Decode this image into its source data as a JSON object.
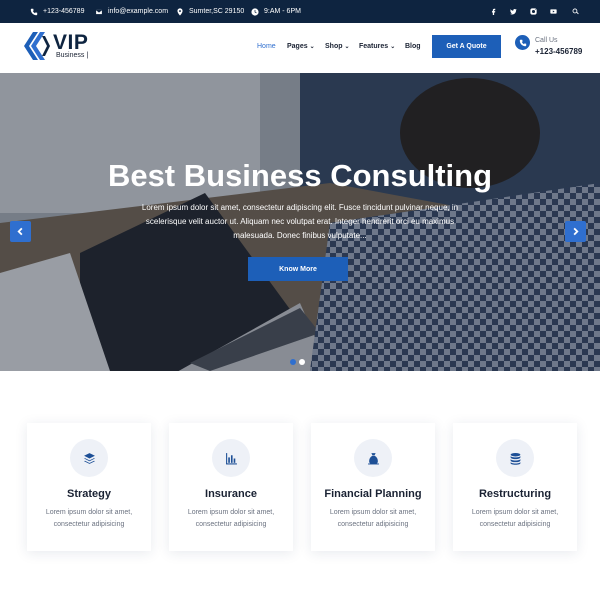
{
  "topbar": {
    "phone": "+123-456789",
    "email": "info@example.com",
    "location": "Sumter,SC 29150",
    "hours": "9:AM - 6PM",
    "social_icons": [
      "facebook-icon",
      "twitter-icon",
      "instagram-icon",
      "youtube-icon",
      "search-icon"
    ]
  },
  "header": {
    "logo_title": "VIP",
    "logo_subtitle": "Business |",
    "nav": [
      {
        "label": "Home",
        "active": true
      },
      {
        "label": "Pages",
        "dropdown": true
      },
      {
        "label": "Shop",
        "dropdown": true
      },
      {
        "label": "Features",
        "dropdown": true
      },
      {
        "label": "Blog"
      }
    ],
    "quote_button": "Get A Quote",
    "call_label": "Call Us",
    "call_number": "+123-456789"
  },
  "hero": {
    "title": "Best Business Consulting",
    "text": "Lorem ipsum dolor sit amet, consectetur adipiscing elit. Fusce tincidunt pulvinar neque, in scelerisque velit auctor ut. Aliquam nec volutpat erat. Integer hendrerit orci eu maximus malesuada. Donec finibus vulputate...",
    "button": "Know More",
    "slides_count": 2,
    "active_slide": 1
  },
  "services": [
    {
      "title": "Strategy",
      "text": "Lorem ipsum dolor sit amet, consectetur adipisicing",
      "icon": "layers-icon"
    },
    {
      "title": "Insurance",
      "text": "Lorem ipsum dolor sit amet, consectetur adipisicing",
      "icon": "bar-chart-icon"
    },
    {
      "title": "Financial Planning",
      "text": "Lorem ipsum dolor sit amet, consectetur adipisicing",
      "icon": "money-bag-icon"
    },
    {
      "title": "Restructuring",
      "text": "Lorem ipsum dolor sit amet, consectetur adipisicing",
      "icon": "coins-icon"
    }
  ],
  "colors": {
    "topbar_bg": "#0e2440",
    "accent": "#1d5fb8",
    "nav_active": "#2f6fcf"
  }
}
